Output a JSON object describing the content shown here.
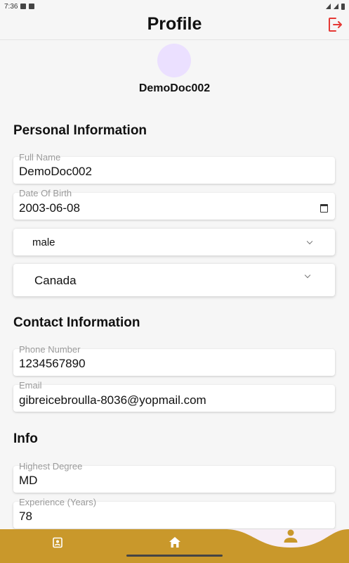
{
  "status": {
    "time": "7:36"
  },
  "header": {
    "title": "Profile"
  },
  "profile": {
    "username": "DemoDoc002"
  },
  "personal": {
    "heading": "Personal Information",
    "full_name": {
      "label": "Full Name",
      "value": "DemoDoc002"
    },
    "dob": {
      "label": "Date Of Birth",
      "value": "2003-06-08"
    },
    "gender": {
      "value": "male"
    },
    "country": {
      "value": "Canada"
    }
  },
  "contact": {
    "heading": "Contact Information",
    "phone": {
      "label": "Phone Number",
      "value": "1234567890"
    },
    "email": {
      "label": "Email",
      "value": "gibreicebroulla-8036@yopmail.com"
    }
  },
  "info": {
    "heading": "Info",
    "degree": {
      "label": "Highest Degree",
      "value": "MD"
    },
    "experience": {
      "label": "Experience (Years)",
      "value": "78"
    }
  },
  "nav": {
    "items": [
      {
        "icon": "contacts-book-icon"
      },
      {
        "icon": "home-icon"
      },
      {
        "icon": "person-icon",
        "active": true
      }
    ],
    "background": "#c9982b",
    "active_background": "#f7eef6"
  },
  "colors": {
    "accent": "#c9982b",
    "logout": "#e53935",
    "avatar": "#ebe0ff"
  }
}
